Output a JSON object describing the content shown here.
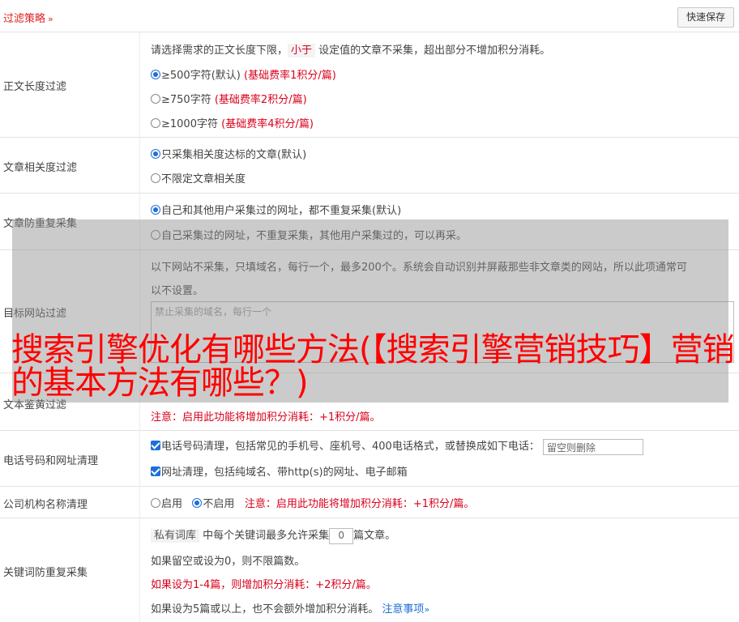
{
  "header": {
    "title": "过滤策略",
    "title_chevron": "»",
    "quick_save": "快速保存"
  },
  "length_filter": {
    "label": "正文长度过滤",
    "desc_before": "请选择需求的正文长度下限，",
    "desc_tag": "小于",
    "desc_after": "设定值的文章不采集，超出部分不增加积分消耗。",
    "options": [
      {
        "text": "≥500字符(默认)",
        "note": "(基础费率1积分/篇)",
        "selected": true
      },
      {
        "text": "≥750字符",
        "note": "(基础费率2积分/篇)",
        "selected": false
      },
      {
        "text": "≥1000字符",
        "note": "(基础费率4积分/篇)",
        "selected": false
      }
    ]
  },
  "relevance_filter": {
    "label": "文章相关度过滤",
    "options": [
      {
        "text": "只采集相关度达标的文章(默认)",
        "selected": true
      },
      {
        "text": "不限定文章相关度",
        "selected": false
      }
    ]
  },
  "dedupe": {
    "label": "文章防重复采集",
    "options": [
      {
        "text": "自己和其他用户采集过的网址，都不重复采集(默认)",
        "selected": true
      },
      {
        "text": "自己采集过的网址，不重复采集，其他用户采集过的，可以再采。",
        "selected": false
      }
    ]
  },
  "site_filter": {
    "label": "目标网站过滤",
    "desc_line1": "以下网站不采集，只填域名，每行一个，最多200个。系统会自动识别并屏蔽那些非文章类的网站，所以此项通常可",
    "desc_line2": "以不设置。",
    "placeholder": "禁止采集的域名，每行一个"
  },
  "text_review": {
    "label": "文本鉴黄过滤",
    "note": "注意：启用此功能将增加积分消耗：+1积分/篇。"
  },
  "phone_url_clean": {
    "label": "电话号码和网址清理",
    "phone_text": "电话号码清理，包括常见的手机号、座机号、400电话格式，或替换成如下电话：",
    "phone_placeholder": "留空则删除",
    "url_text": "网址清理，包括纯域名、带http(s)的网址、电子邮箱"
  },
  "org_clean": {
    "label": "公司机构名称清理",
    "enable": "启用",
    "disable": "不启用",
    "note": "注意：启用此功能将增加积分消耗：+1积分/篇。"
  },
  "keyword_dedupe": {
    "label": "关键词防重复采集",
    "tag": "私有词库",
    "text_before": "中每个关键词最多允许采集",
    "value": "0",
    "text_after": "篇文章。",
    "line2": "如果留空或设为0，则不限篇数。",
    "line3": "如果设为1-4篇，则增加积分消耗：+2积分/篇。",
    "line4": "如果设为5篇或以上，也不会额外增加积分消耗。",
    "link": "注意事项"
  },
  "overlay_title": "搜索引擎优化有哪些方法(【搜索引擎营销技巧】营销的基本方法有哪些？)"
}
